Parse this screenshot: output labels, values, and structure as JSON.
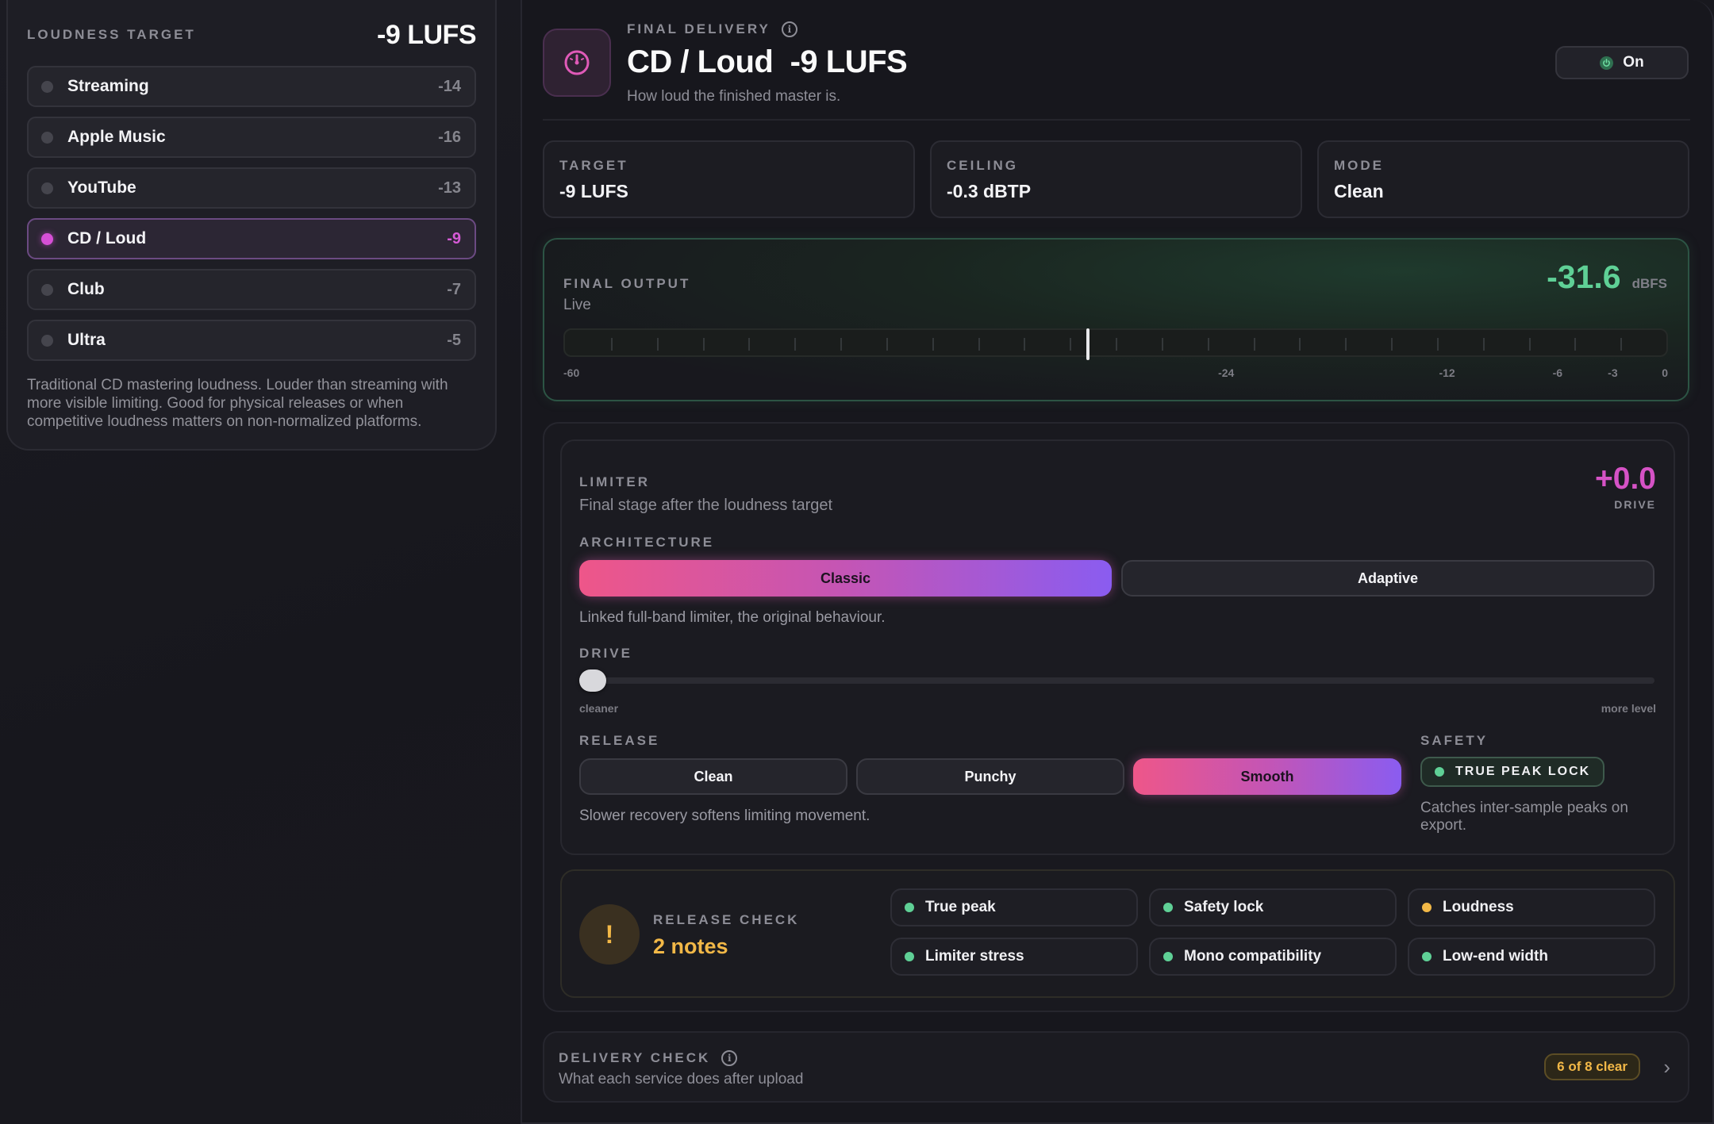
{
  "left": {
    "title": "LOUDNESS TARGET",
    "value": "-9 LUFS",
    "presets": [
      {
        "name": "Streaming",
        "value": "-14",
        "active": false
      },
      {
        "name": "Apple Music",
        "value": "-16",
        "active": false
      },
      {
        "name": "YouTube",
        "value": "-13",
        "active": false
      },
      {
        "name": "CD / Loud",
        "value": "-9",
        "active": true
      },
      {
        "name": "Club",
        "value": "-7",
        "active": false
      },
      {
        "name": "Ultra",
        "value": "-5",
        "active": false
      }
    ],
    "description": "Traditional CD mastering loudness. Louder than streaming with more visible limiting. Good for physical releases or when competitive loudness matters on non-normalized platforms."
  },
  "header": {
    "icon": "gauge-icon",
    "eyebrow": "FINAL DELIVERY",
    "title": "CD / Loud  -9 LUFS",
    "subtitle": "How loud the finished master is.",
    "power_label": "On"
  },
  "stats": [
    {
      "label": "TARGET",
      "value": "-9 LUFS"
    },
    {
      "label": "CEILING",
      "value": "-0.3 dBTP"
    },
    {
      "label": "MODE",
      "value": "Clean"
    }
  ],
  "output": {
    "label": "FINAL OUTPUT",
    "status": "Live",
    "value": "-31.6",
    "unit": "dBFS",
    "meter_level_db": -31.6,
    "scale": [
      "-60",
      "-24",
      "-12",
      "-6",
      "-3",
      "0"
    ]
  },
  "limiter": {
    "title": "LIMITER",
    "subtitle": "Final stage after the loudness target",
    "drive_value": "+0.0",
    "drive_label": "DRIVE",
    "architecture_label": "ARCHITECTURE",
    "architecture_options": [
      "Classic",
      "Adaptive"
    ],
    "architecture_selected": "Classic",
    "architecture_note": "Linked full-band limiter, the original behaviour.",
    "drive_section_label": "DRIVE",
    "drive_fraction": 0.0,
    "drive_min_label": "cleaner",
    "drive_max_label": "more level",
    "release_label": "RELEASE",
    "release_options": [
      "Clean",
      "Punchy",
      "Smooth"
    ],
    "release_selected": "Smooth",
    "release_note": "Slower recovery softens limiting movement.",
    "safety_label": "SAFETY",
    "safety_toggle": "TRUE PEAK LOCK",
    "safety_note": "Catches inter-sample peaks on export."
  },
  "release_check": {
    "label": "RELEASE CHECK",
    "value": "2 notes",
    "items": [
      {
        "label": "True peak",
        "status": "ok"
      },
      {
        "label": "Safety lock",
        "status": "ok"
      },
      {
        "label": "Loudness",
        "status": "warn"
      },
      {
        "label": "Limiter stress",
        "status": "ok"
      },
      {
        "label": "Mono compatibility",
        "status": "ok"
      },
      {
        "label": "Low-end width",
        "status": "ok"
      }
    ]
  },
  "delivery": {
    "label": "DELIVERY CHECK",
    "subtitle": "What each service does after upload",
    "badge": "6 of 8 clear"
  },
  "colors": {
    "accent_pink": "#ee5689",
    "accent_violet": "#8a5cf0",
    "ok_green": "#5fd096",
    "warn_amber": "#f2b847"
  }
}
